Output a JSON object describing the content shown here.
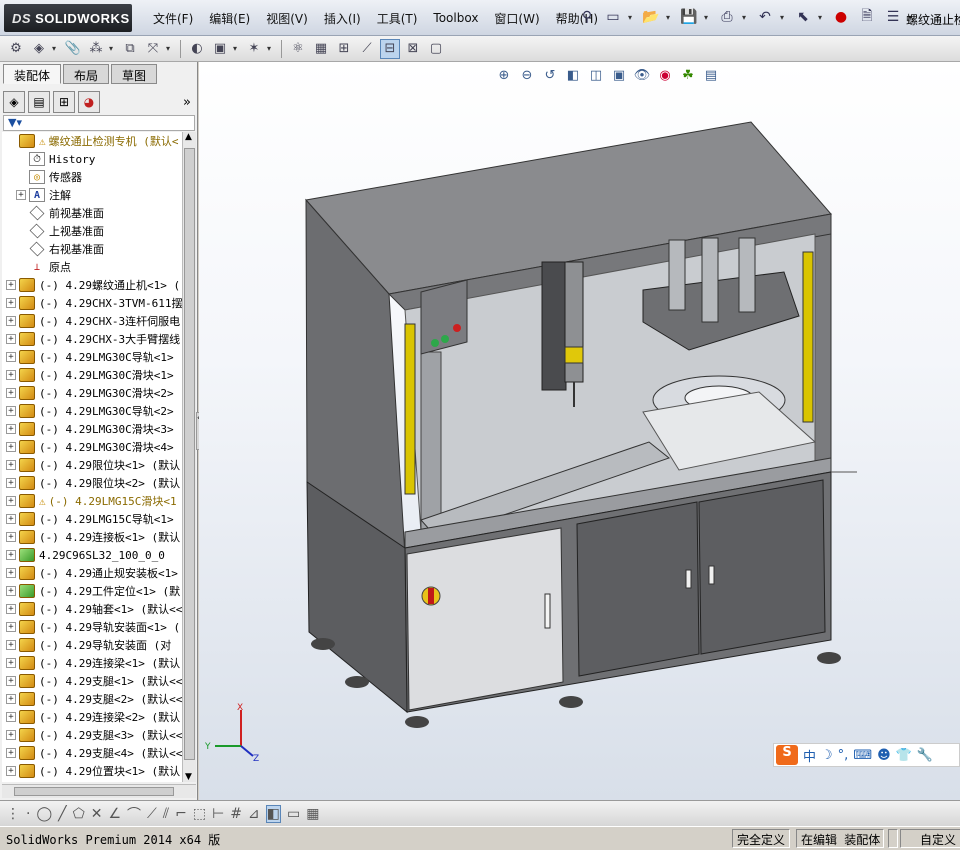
{
  "app": {
    "logo_text": "SOLIDWORKS",
    "logo_prefix": "DS",
    "doc_title": "螺纹通止检"
  },
  "menu": [
    "文件(F)",
    "编辑(E)",
    "视图(V)",
    "插入(I)",
    "工具(T)",
    "Toolbox",
    "窗口(W)",
    "帮助(H)"
  ],
  "left_panel": {
    "tabs": [
      "装配体",
      "布局",
      "草图"
    ],
    "active_tab": 0,
    "more_label": "»"
  },
  "tree": [
    {
      "label": "螺纹通止检测专机 (默认<",
      "icon": "assembly",
      "warn": true,
      "expand": false,
      "top": true
    },
    {
      "label": "History",
      "icon": "history",
      "expand": false,
      "indent": true
    },
    {
      "label": "传感器",
      "icon": "sensor",
      "expand": false,
      "indent": true
    },
    {
      "label": "注解",
      "icon": "annotation",
      "expand": true,
      "indent": true
    },
    {
      "label": "前视基准面",
      "icon": "plane",
      "expand": false,
      "indent": true
    },
    {
      "label": "上视基准面",
      "icon": "plane",
      "expand": false,
      "indent": true
    },
    {
      "label": "右视基准面",
      "icon": "plane",
      "expand": false,
      "indent": true
    },
    {
      "label": "原点",
      "icon": "origin",
      "expand": false,
      "indent": true
    },
    {
      "label": "(-) 4.29螺纹通止机<1> (",
      "icon": "part",
      "expand": true
    },
    {
      "label": "(-) 4.29CHX-3TVM-611摆线",
      "icon": "part",
      "expand": true
    },
    {
      "label": "(-) 4.29CHX-3连杆伺服电",
      "icon": "part",
      "expand": true
    },
    {
      "label": "(-) 4.29CHX-3大手臂摆线",
      "icon": "part",
      "expand": true
    },
    {
      "label": "(-) 4.29LMG30C导轨<1> (",
      "icon": "part",
      "expand": true
    },
    {
      "label": "(-) 4.29LMG30C滑块<1> (",
      "icon": "part",
      "expand": true
    },
    {
      "label": "(-) 4.29LMG30C滑块<2> (",
      "icon": "part",
      "expand": true
    },
    {
      "label": "(-) 4.29LMG30C导轨<2> (",
      "icon": "part",
      "expand": true
    },
    {
      "label": "(-) 4.29LMG30C滑块<3> (",
      "icon": "part",
      "expand": true
    },
    {
      "label": "(-) 4.29LMG30C滑块<4> (",
      "icon": "part",
      "expand": true
    },
    {
      "label": "(-) 4.29限位块<1> (默认",
      "icon": "part",
      "expand": true
    },
    {
      "label": "(-) 4.29限位块<2> (默认",
      "icon": "part",
      "expand": true
    },
    {
      "label": "(-) 4.29LMG15C滑块<1",
      "icon": "part",
      "expand": true,
      "warn": true
    },
    {
      "label": "(-) 4.29LMG15C导轨<1> (",
      "icon": "part",
      "expand": true
    },
    {
      "label": "(-) 4.29连接板<1> (默认",
      "icon": "part",
      "expand": true
    },
    {
      "label": "4.29C96SL32_100_0_0",
      "icon": "part-green",
      "expand": true
    },
    {
      "label": "(-) 4.29通止规安装板<1>",
      "icon": "part",
      "expand": true
    },
    {
      "label": "(-) 4.29工件定位<1> (默",
      "icon": "part-green",
      "expand": true
    },
    {
      "label": "(-) 4.29轴套<1> (默认<<",
      "icon": "part",
      "expand": true
    },
    {
      "label": "(-) 4.29导轨安装面<1> (",
      "icon": "part",
      "expand": true
    },
    {
      "label": "(-) 4.29导轨安装面 (对",
      "icon": "part",
      "expand": true
    },
    {
      "label": "(-) 4.29连接梁<1> (默认",
      "icon": "part",
      "expand": true
    },
    {
      "label": "(-) 4.29支腿<1> (默认<<",
      "icon": "part",
      "expand": true
    },
    {
      "label": "(-) 4.29支腿<2> (默认<<",
      "icon": "part",
      "expand": true
    },
    {
      "label": "(-) 4.29连接梁<2> (默认",
      "icon": "part",
      "expand": true
    },
    {
      "label": "(-) 4.29支腿<3> (默认<<",
      "icon": "part",
      "expand": true
    },
    {
      "label": "(-) 4.29支腿<4> (默认<<",
      "icon": "part",
      "expand": true
    },
    {
      "label": "(-) 4.29位置块<1> (默认",
      "icon": "part",
      "expand": true
    }
  ],
  "triad": {
    "x": "X",
    "y": "Y",
    "z": "Z"
  },
  "ime": {
    "logo": "S",
    "lang": "中"
  },
  "status": {
    "product": "SolidWorks Premium 2014 x64 版",
    "definition": "完全定义",
    "mode": "在编辑 装配体",
    "custom": "自定义"
  },
  "colors": {
    "accent": "#3a5c8c",
    "warning": "#c48a00",
    "cabinet": "#6f7073"
  }
}
